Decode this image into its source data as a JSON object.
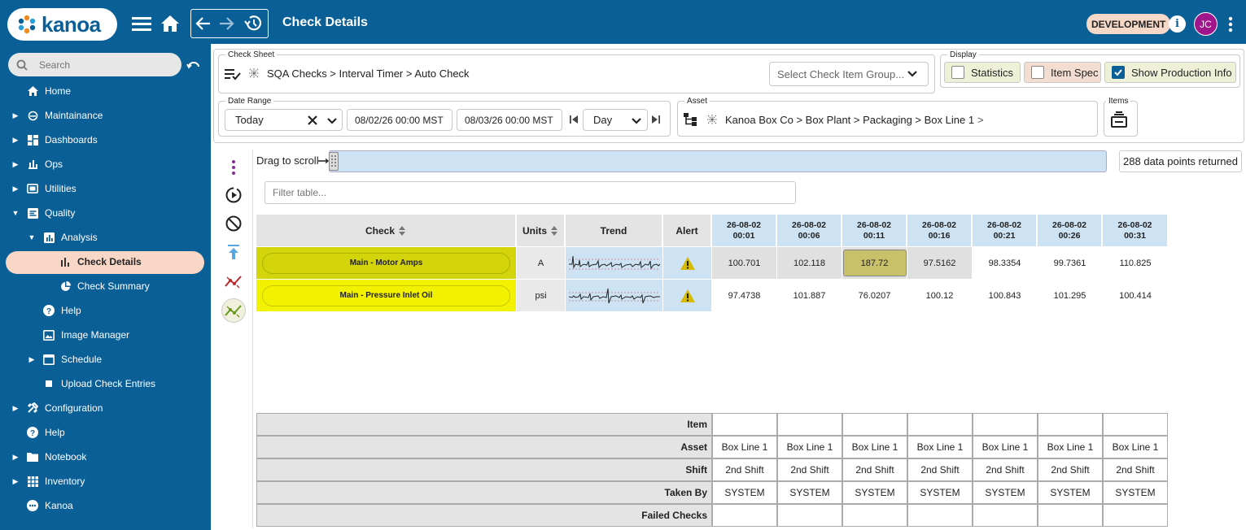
{
  "topbar": {
    "logo_text": "kanoa",
    "title": "Check Details",
    "env_badge": "DEVELOPMENT",
    "avatar_initials": "JC"
  },
  "sidebar": {
    "search_placeholder": "Search",
    "items": [
      {
        "label": "Home"
      },
      {
        "label": "Maintainance"
      },
      {
        "label": "Dashboards"
      },
      {
        "label": "Ops"
      },
      {
        "label": "Utilities"
      },
      {
        "label": "Quality"
      },
      {
        "label": "Analysis"
      },
      {
        "label": "Check Details"
      },
      {
        "label": "Check Summary"
      },
      {
        "label": "Help"
      },
      {
        "label": "Image Manager"
      },
      {
        "label": "Schedule"
      },
      {
        "label": "Upload Check Entries"
      },
      {
        "label": "Configuration"
      },
      {
        "label": "Help"
      },
      {
        "label": "Notebook"
      },
      {
        "label": "Inventory"
      },
      {
        "label": "Kanoa"
      }
    ]
  },
  "check_sheet": {
    "legend": "Check Sheet",
    "path": "SQA Checks > Interval Timer > Auto Check",
    "group_placeholder": "Select Check Item Group..."
  },
  "display": {
    "legend": "Display",
    "statistics": "Statistics",
    "item_spec": "Item Spec",
    "show_production_info": "Show Production Info"
  },
  "date_range": {
    "legend": "Date Range",
    "preset": "Today",
    "start": "08/02/26 00:00 MST",
    "end": "08/03/26 00:00 MST",
    "interval": "Day"
  },
  "asset": {
    "legend": "Asset",
    "path": "Kanoa Box Co > Box Plant > Packaging > Box Line 1",
    "chevron": ">"
  },
  "items": {
    "legend": "Items"
  },
  "scroll": {
    "label": "Drag to scroll",
    "points_returned": "288 data points returned",
    "filter_placeholder": "Filter table..."
  },
  "table": {
    "headers": {
      "check": "Check",
      "units": "Units",
      "trend": "Trend",
      "alert": "Alert"
    },
    "times": [
      {
        "date": "26-08-02",
        "time": "00:01"
      },
      {
        "date": "26-08-02",
        "time": "00:06"
      },
      {
        "date": "26-08-02",
        "time": "00:11"
      },
      {
        "date": "26-08-02",
        "time": "00:16"
      },
      {
        "date": "26-08-02",
        "time": "00:21"
      },
      {
        "date": "26-08-02",
        "time": "00:26"
      },
      {
        "date": "26-08-02",
        "time": "00:31"
      }
    ],
    "rows": [
      {
        "check": "Main - Motor Amps",
        "units": "A",
        "values": [
          "100.701",
          "102.118",
          "187.72",
          "97.5162",
          "98.3354",
          "99.7361",
          "110.825"
        ]
      },
      {
        "check": "Main - Pressure Inlet Oil",
        "units": "psi",
        "values": [
          "97.4738",
          "101.887",
          "76.0207",
          "100.12",
          "100.843",
          "101.295",
          "100.414"
        ]
      }
    ]
  },
  "production": {
    "labels": {
      "item": "Item",
      "asset": "Asset",
      "shift": "Shift",
      "taken_by": "Taken By",
      "failed": "Failed Checks"
    },
    "asset": [
      "Box Line 1",
      "Box Line 1",
      "Box Line 1",
      "Box Line 1",
      "Box Line 1",
      "Box Line 1",
      "Box Line 1"
    ],
    "shift": [
      "2nd Shift",
      "2nd Shift",
      "2nd Shift",
      "2nd Shift",
      "2nd Shift",
      "2nd Shift",
      "2nd Shift"
    ],
    "taken_by": [
      "SYSTEM",
      "SYSTEM",
      "SYSTEM",
      "SYSTEM",
      "SYSTEM",
      "SYSTEM",
      "SYSTEM"
    ]
  },
  "colors": {
    "brand": "#0a5f97",
    "active_nav": "#f9d7c7",
    "row1_check": "#d4d40a",
    "row2_check": "#f2f200",
    "highlight_cell": "#c9c06a",
    "header_blue": "#cde2f3"
  }
}
